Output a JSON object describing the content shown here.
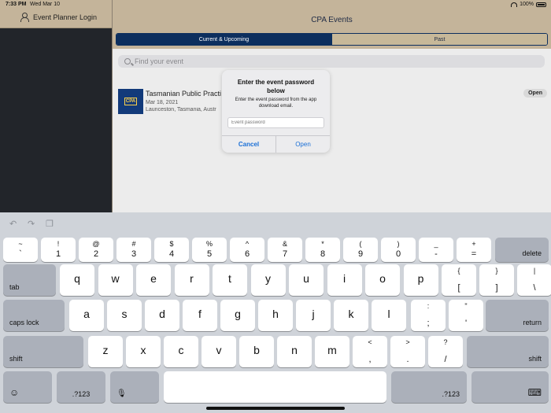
{
  "status": {
    "time": "7:33 PM",
    "date": "Wed Mar 10",
    "battery": "100%"
  },
  "sidebar": {
    "login_label": "Event Planner Login"
  },
  "header": {
    "title": "CPA Events"
  },
  "segments": {
    "current": "Current & Upcoming",
    "past": "Past"
  },
  "search": {
    "placeholder": "Find your event"
  },
  "event": {
    "logo": "CPA",
    "name": "Tasmanian Public Practi",
    "date": "Mar 18, 2021",
    "location": "Launceston, Tasmania, Austr",
    "status": "Open"
  },
  "dialog": {
    "title": "Enter the event password below",
    "message": "Enter the event password from the app download email.",
    "input_placeholder": "Event password",
    "cancel": "Cancel",
    "open": "Open"
  },
  "toolbar": {
    "undo_icon": "↶",
    "redo_icon": "↷",
    "paste_icon": "❐"
  },
  "keyboard": {
    "row1": [
      {
        "t": "~",
        "b": "`"
      },
      {
        "t": "!",
        "b": "1"
      },
      {
        "t": "@",
        "b": "2"
      },
      {
        "t": "#",
        "b": "3"
      },
      {
        "t": "$",
        "b": "4"
      },
      {
        "t": "%",
        "b": "5"
      },
      {
        "t": "^",
        "b": "6"
      },
      {
        "t": "&",
        "b": "7"
      },
      {
        "t": "*",
        "b": "8"
      },
      {
        "t": "(",
        "b": "9"
      },
      {
        "t": ")",
        "b": "0"
      },
      {
        "t": "_",
        "b": "-"
      },
      {
        "t": "+",
        "b": "="
      }
    ],
    "delete": "delete",
    "tab": "tab",
    "row2": [
      "q",
      "w",
      "e",
      "r",
      "t",
      "y",
      "u",
      "i",
      "o",
      "p"
    ],
    "row2_sym": [
      {
        "t": "{",
        "b": "["
      },
      {
        "t": "}",
        "b": "]"
      },
      {
        "t": "|",
        "b": "\\"
      }
    ],
    "caps": "caps lock",
    "row3": [
      "a",
      "s",
      "d",
      "f",
      "g",
      "h",
      "j",
      "k",
      "l"
    ],
    "row3_sym": [
      {
        "t": ":",
        "b": ";"
      },
      {
        "t": "\"",
        "b": "'"
      }
    ],
    "return": "return",
    "shift": "shift",
    "row4": [
      "z",
      "x",
      "c",
      "v",
      "b",
      "n",
      "m"
    ],
    "row4_sym": [
      {
        "t": "<",
        "b": ","
      },
      {
        "t": ">",
        "b": "."
      },
      {
        "t": "?",
        "b": "/"
      }
    ],
    "numbers": ".?123",
    "emoji_icon": "☺",
    "mic_icon": "🎙",
    "dismiss_icon": "⌨"
  }
}
